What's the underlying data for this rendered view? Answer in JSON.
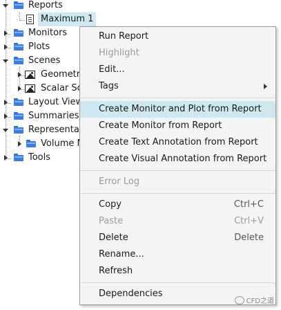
{
  "tree": {
    "reports": "Reports",
    "maximum": "Maximum 1",
    "monitors": "Monitors",
    "plots": "Plots",
    "scenes": "Scenes",
    "geometry": "Geometry",
    "scalar_scene": "Scalar Sc",
    "layout_views": "Layout View",
    "summaries": "Summaries",
    "representations": "Representat",
    "volume_mesh": "Volume M",
    "tools": "Tools"
  },
  "menu": {
    "run_report": "Run Report",
    "highlight": "Highlight",
    "edit": "Edit...",
    "tags": "Tags",
    "create_monitor_plot": "Create Monitor and Plot from Report",
    "create_monitor": "Create Monitor from Report",
    "create_text_annotation": "Create Text Annotation from Report",
    "create_visual_annotation": "Create Visual Annotation from Report",
    "error_log": "Error Log",
    "copy": "Copy",
    "copy_shortcut": "Ctrl+C",
    "paste": "Paste",
    "paste_shortcut": "Ctrl+V",
    "delete": "Delete",
    "delete_shortcut": "Delete",
    "rename": "Rename...",
    "refresh": "Refresh",
    "dependencies": "Dependencies"
  },
  "watermark": "CFD之道",
  "colors": {
    "folder_blue": "#3b7ee6",
    "selection": "#cde8f0",
    "menu_bg": "#f4f4f4",
    "disabled_text": "#9b9b9b"
  }
}
